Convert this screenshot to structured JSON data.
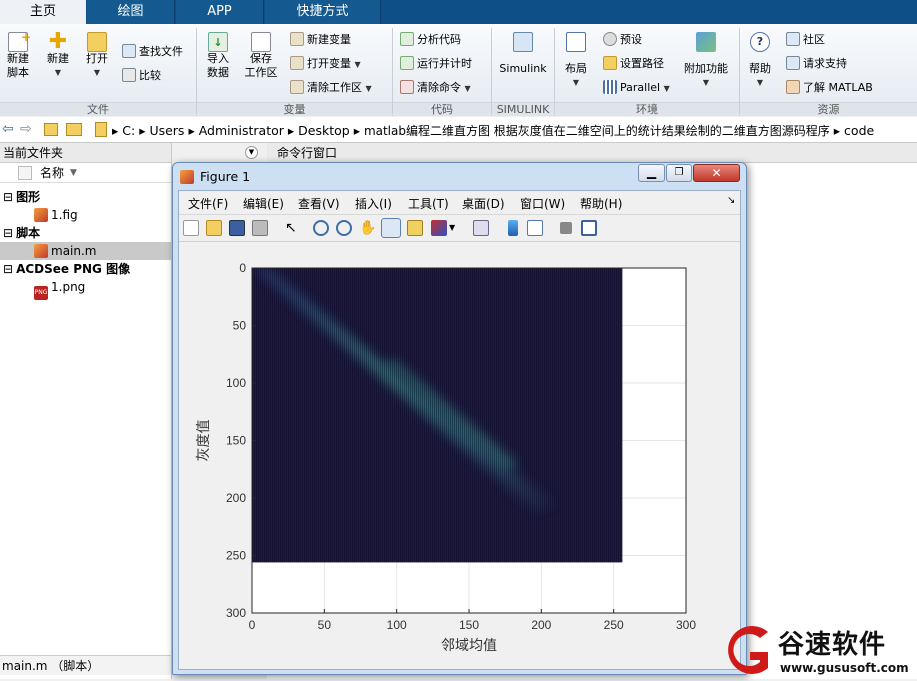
{
  "tabs": [
    "主页",
    "绘图",
    "APP",
    "快捷方式"
  ],
  "ribbon": {
    "new_script": "新建\n脚本",
    "new": "新建",
    "open": "打开",
    "find_files": "查找文件",
    "compare": "比较",
    "import_data": "导入\n数据",
    "save_workspace": "保存\n工作区",
    "new_variable": "新建变量",
    "open_variable": "打开变量",
    "clear_workspace": "清除工作区",
    "analyze_code": "分析代码",
    "run_and_time": "运行并计时",
    "clear_commands": "清除命令",
    "simulink": "Simulink",
    "layout": "布局",
    "preferences": "预设",
    "set_path": "设置路径",
    "parallel": "Parallel",
    "addons": "附加功能",
    "help": "帮助",
    "community": "社区",
    "request_support": "请求支持",
    "learn_matlab": "了解 MATLAB",
    "sections": [
      "文件",
      "变量",
      "代码",
      "SIMULINK",
      "环境",
      "资源"
    ]
  },
  "address": {
    "parts": [
      "C:",
      "Users",
      "Administrator",
      "Desktop",
      "matlab编程二维直方图 根据灰度值在二维空间上的统计结果绘制的二维直方图源码程序",
      "code"
    ]
  },
  "left_panel": {
    "title": "当前文件夹",
    "column": "名称",
    "groups": [
      {
        "label": "图形",
        "files": [
          "1.fig"
        ]
      },
      {
        "label": "脚本",
        "files": [
          "main.m"
        ]
      },
      {
        "label": "ACDSee PNG 图像",
        "files": [
          "1.png"
        ]
      }
    ],
    "status": "main.m （脚本）"
  },
  "command_window": {
    "title": "命令行窗口"
  },
  "figure": {
    "title": "Figure 1",
    "menus": [
      "文件(F)",
      "编辑(E)",
      "查看(V)",
      "插入(I)",
      "工具(T)",
      "桌面(D)",
      "窗口(W)",
      "帮助(H)"
    ]
  },
  "chart_data": {
    "type": "heatmap",
    "xlabel": "邻域均值",
    "ylabel": "灰度值",
    "xlim": [
      0,
      300
    ],
    "ylim": [
      0,
      300
    ],
    "xticks": [
      0,
      50,
      100,
      150,
      200,
      250,
      300
    ],
    "yticks": [
      0,
      50,
      100,
      150,
      200,
      250,
      300
    ],
    "y_reversed": true,
    "image_extent": {
      "x": [
        0,
        256
      ],
      "y": [
        0,
        256
      ]
    },
    "colormap": "parula",
    "values": "diagonal band of higher counts from (0,0) to about (200,200); background near zero"
  },
  "watermark": {
    "brand": "谷速软件",
    "url": "www.gususoft.com"
  },
  "colors": {
    "tab_bar": "#0e4f87",
    "heat_bg": "#1e1a4f",
    "band": "#2f8a8c"
  }
}
